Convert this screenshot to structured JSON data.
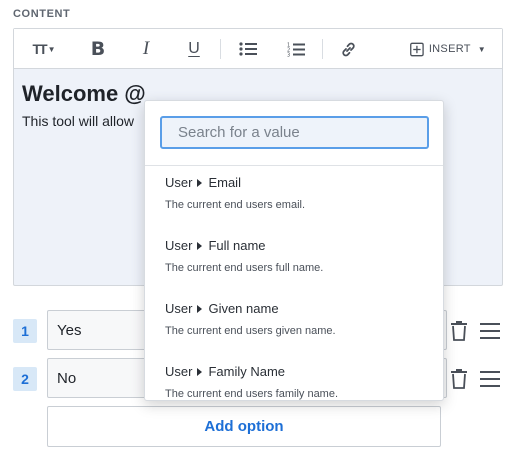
{
  "section": {
    "label": "CONTENT"
  },
  "toolbar": {
    "text_size_icon": "text-size-icon",
    "bold_icon": "bold-icon",
    "italic_icon": "italic-icon",
    "underline_icon": "underline-icon",
    "bullets_icon": "bulleted-list-icon",
    "numbers_icon": "numbered-list-icon",
    "link_icon": "link-icon",
    "insert_label": "INSERT",
    "bold_glyph": "B",
    "italic_glyph": "I",
    "underline_glyph": "U",
    "text_size_glyph": "TT"
  },
  "editor": {
    "heading": "Welcome @",
    "paragraph": "This tool will allow"
  },
  "options": [
    {
      "number": "1",
      "value": "Yes"
    },
    {
      "number": "2",
      "value": "No"
    }
  ],
  "add_option_label": "Add option",
  "popup": {
    "search_placeholder": "Search for a value",
    "items": [
      {
        "group": "User",
        "name": "Email",
        "description": "The current end users email."
      },
      {
        "group": "User",
        "name": "Full name",
        "description": "The current end users full name."
      },
      {
        "group": "User",
        "name": "Given name",
        "description": "The current end users given name."
      },
      {
        "group": "User",
        "name": "Family Name",
        "description": "The current end users family name."
      }
    ]
  },
  "colors": {
    "accent": "#1d6fd6",
    "badge_bg": "#d8e8f7",
    "focus_border": "#5a9ee8"
  }
}
